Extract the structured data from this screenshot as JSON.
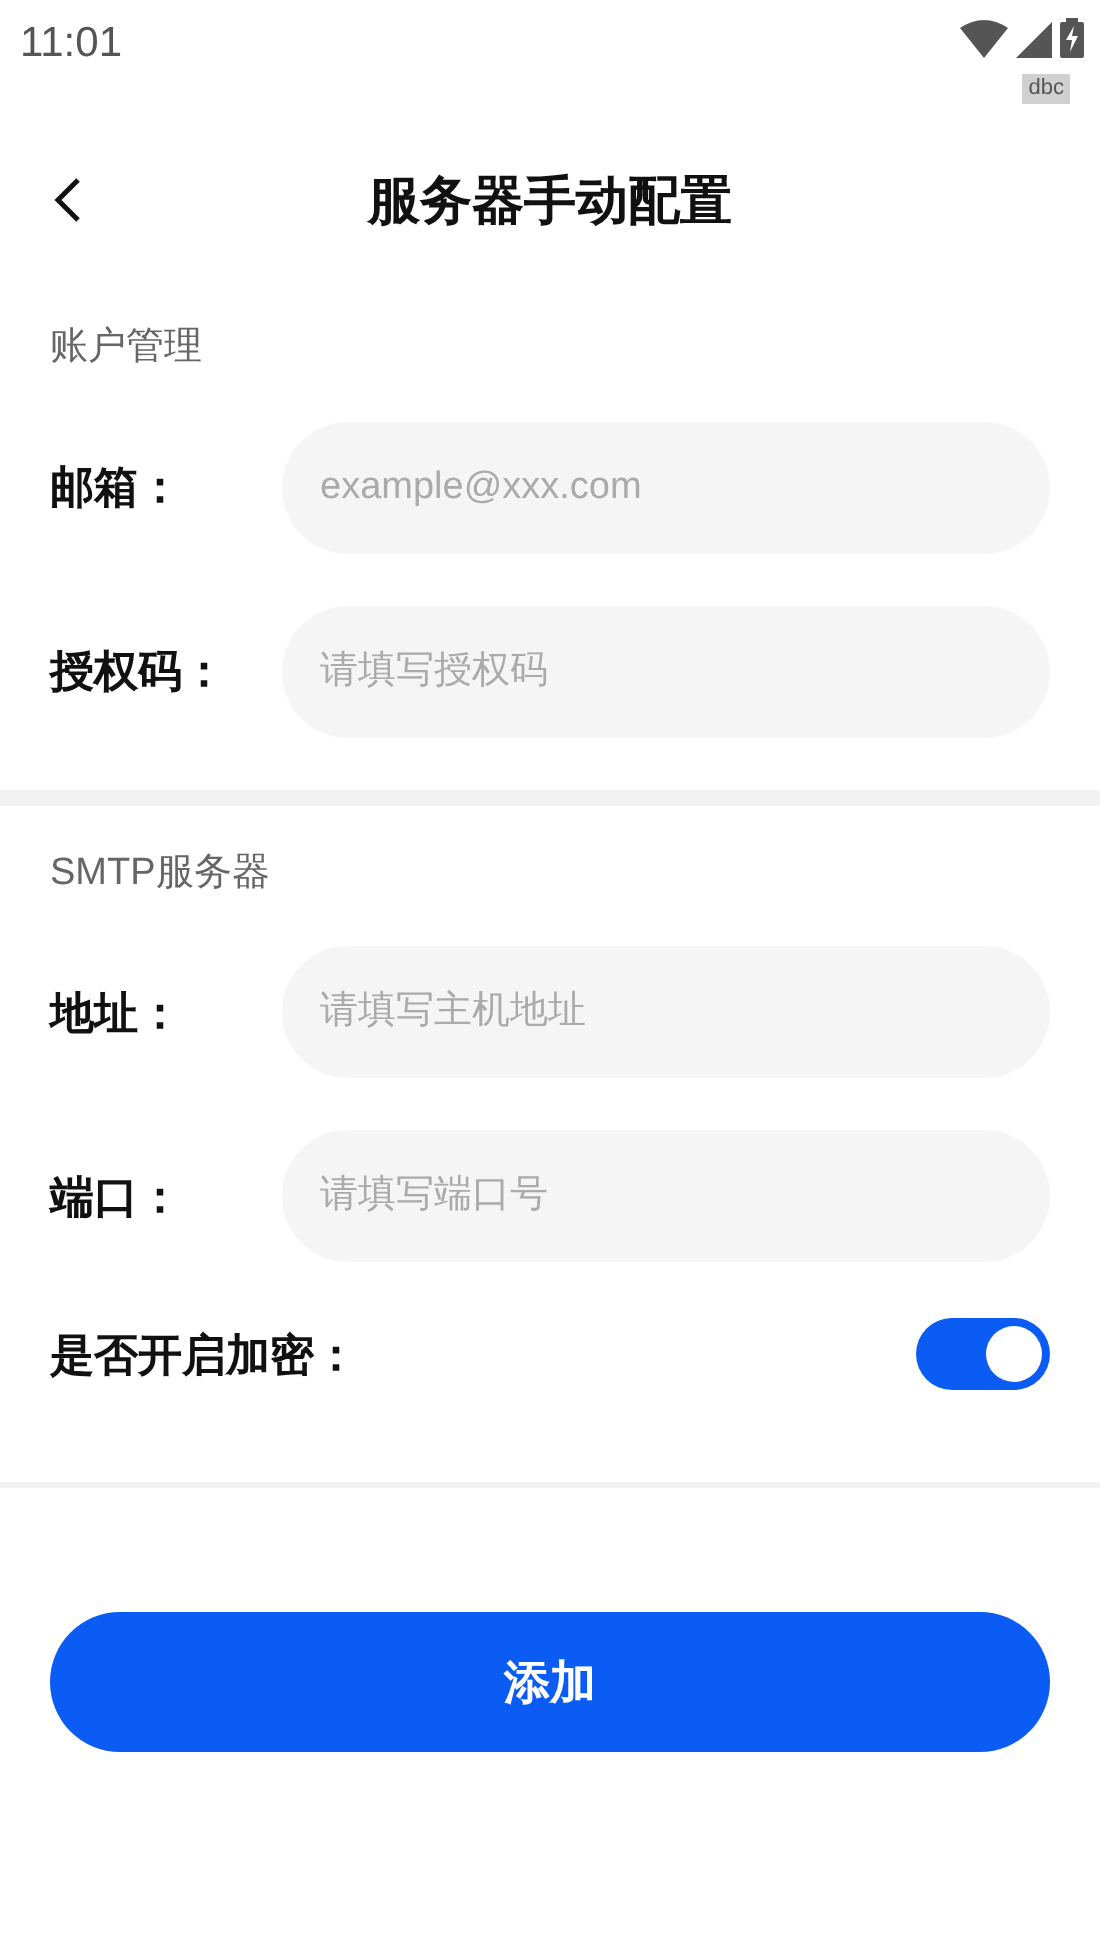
{
  "status_bar": {
    "time": "11:01",
    "badge": "dbc"
  },
  "header": {
    "title": "服务器手动配置"
  },
  "sections": [
    {
      "title": "账户管理",
      "rows": [
        {
          "kind": "field",
          "label": "邮箱：",
          "placeholder": "example@xxx.com"
        },
        {
          "kind": "field",
          "label": "授权码：",
          "placeholder": "请填写授权码"
        }
      ]
    },
    {
      "title": "SMTP服务器",
      "rows": [
        {
          "kind": "field",
          "label": "地址：",
          "placeholder": "请填写主机地址"
        },
        {
          "kind": "field",
          "label": "端口：",
          "placeholder": "请填写端口号"
        },
        {
          "kind": "switch",
          "label": "是否开启加密：",
          "on": true
        }
      ]
    }
  ],
  "submit": {
    "label": "添加"
  }
}
